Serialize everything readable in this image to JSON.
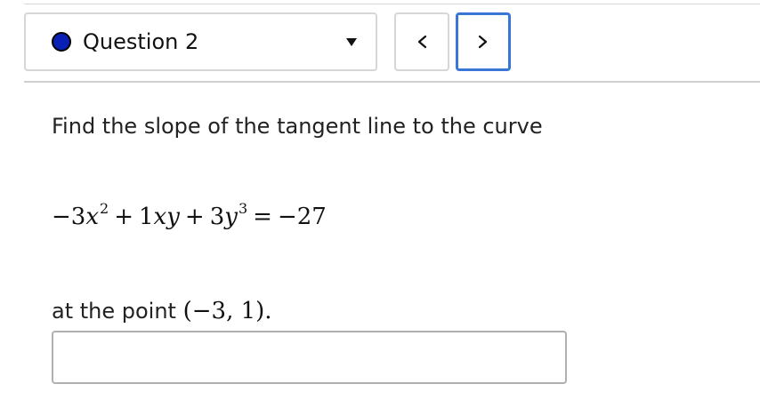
{
  "header": {
    "question_label": "Question 2",
    "status_color": "#0a1fb3",
    "dropdown_icon": "caret-down-icon"
  },
  "nav": {
    "prev_label": "<",
    "next_label": ">",
    "next_focus_color": "#3a76d6"
  },
  "problem": {
    "prompt": "Find the slope of the tangent line to the curve",
    "equation": {
      "term1_sign": "−",
      "term1_coef": "3",
      "term1_var": "x",
      "term1_exp": "2",
      "op1": "+",
      "term2_coef": "1",
      "term2_var1": "x",
      "term2_var2": "y",
      "op2": "+",
      "term3_coef": "3",
      "term3_var": "y",
      "term3_exp": "3",
      "equals": "=",
      "rhs": "−27"
    },
    "point_prefix": "at the point ",
    "point": "(−3, 1).",
    "answer_value": "",
    "answer_placeholder": ""
  }
}
